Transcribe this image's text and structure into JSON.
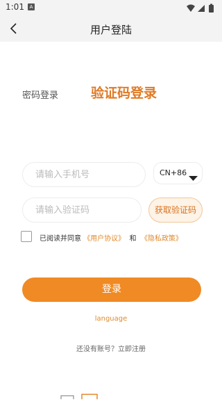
{
  "status_bar": {
    "time": "1:01",
    "notification_badge": "A",
    "icons": [
      "wifi-icon",
      "signal-icon",
      "battery-icon"
    ]
  },
  "nav": {
    "title": "用户登陆",
    "back_icon": "chevron-left-icon"
  },
  "tabs": {
    "password_login": "密码登录",
    "sms_login": "验证码登录",
    "active": "sms_login"
  },
  "form": {
    "phone_placeholder": "请输入手机号",
    "phone_value": "",
    "country_code": "CN+86",
    "code_placeholder": "请输入验证码",
    "code_value": "",
    "get_code_label": "获取验证码"
  },
  "agreement": {
    "checked": false,
    "prefix": "已阅读并同意",
    "user_agreement": "《用户协议》",
    "conjunction": "和",
    "privacy_policy": "《隐私政策》"
  },
  "actions": {
    "login_label": "登录",
    "language_label": "language",
    "register_label": "还没有账号？立即注册"
  },
  "colors": {
    "accent": "#f08a24",
    "accent_text": "#e07a24",
    "light_accent_bg": "#fdf3e6",
    "header_bg": "#f3f3f3"
  }
}
